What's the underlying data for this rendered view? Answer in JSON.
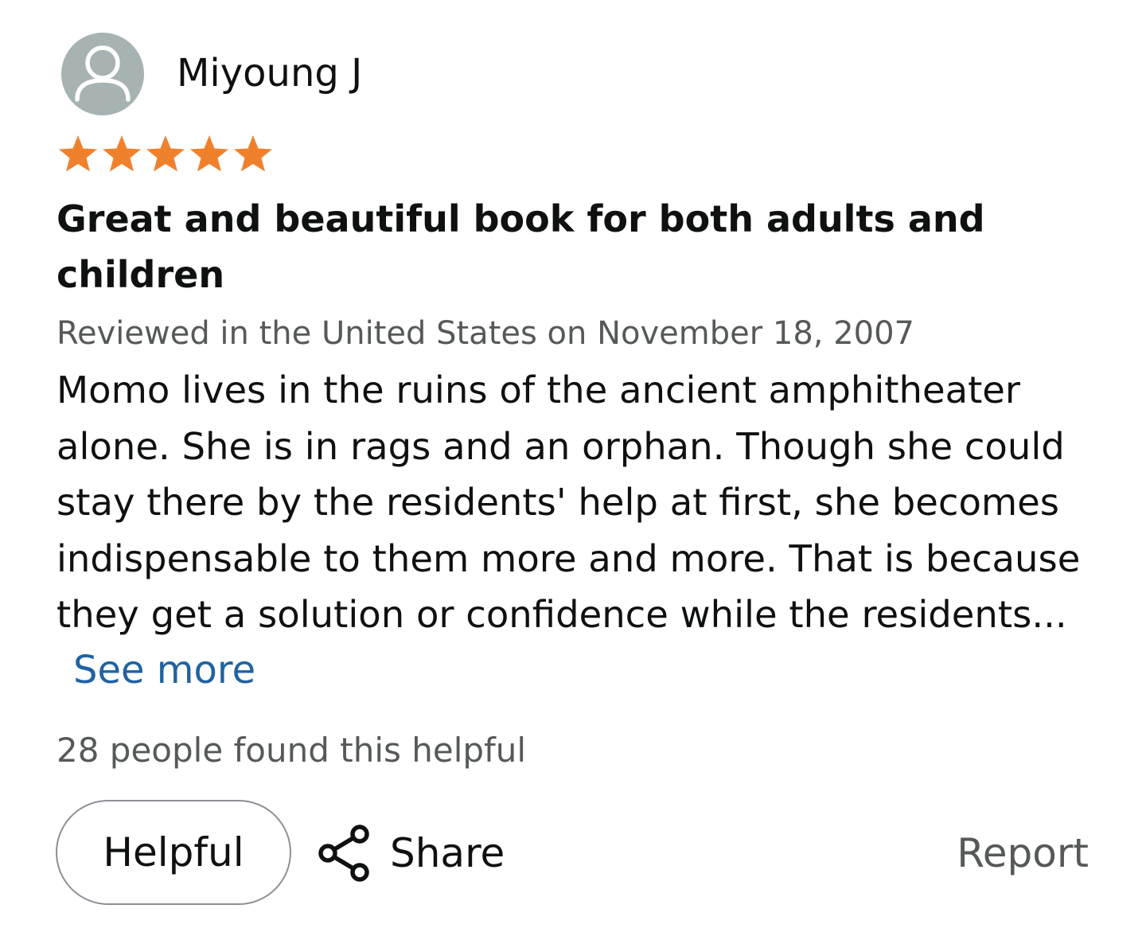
{
  "review": {
    "reviewer_name": "Miyoung J",
    "rating": 5,
    "rating_max": 5,
    "star_color": "#f0812c",
    "title": "Great and beautiful book for both adults and children",
    "meta": "Reviewed in the United States on November 18, 2007",
    "body": "Momo lives in the ruins of the ancient amphitheater alone. She is in rags and an orphan. Though she could stay there by the residents' help at first, she becomes indispensable to them more and more. That is because they get a solution or confidence while the residents...",
    "see_more_label": "See more",
    "helpful_count_text": "28 people found this helpful"
  },
  "actions": {
    "helpful_label": "Helpful",
    "share_label": "Share",
    "report_label": "Report"
  },
  "icons": {
    "avatar": "user-avatar-icon",
    "star": "star-icon",
    "share": "share-icon"
  },
  "colors": {
    "text": "#0f1111",
    "secondary_text": "#565959",
    "link": "#2162a1",
    "avatar_bg": "#a7b3b3",
    "button_border": "#8d9096"
  }
}
